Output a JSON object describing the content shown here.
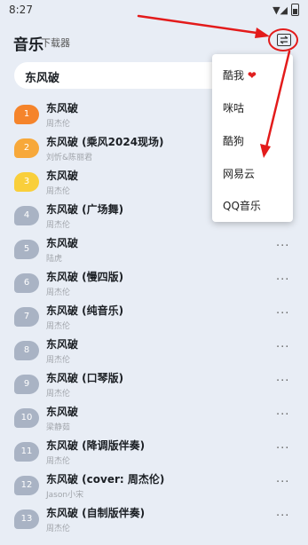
{
  "status_bar": {
    "time": "8:27",
    "signal": "▼◢"
  },
  "header": {
    "title": "音乐",
    "subtitle": "下载器"
  },
  "search": {
    "query": "东风破"
  },
  "results": [
    {
      "rank": "1",
      "title": "东风破",
      "artist": "周杰伦",
      "badge_color": "#f5842b",
      "show_more": false
    },
    {
      "rank": "2",
      "title": "东风破 (乘风2024现场)",
      "artist": "刘忻&陈丽君",
      "badge_color": "#f7a83a",
      "show_more": false
    },
    {
      "rank": "3",
      "title": "东风破",
      "artist": "周杰伦",
      "badge_color": "#f9cf3b",
      "show_more": false
    },
    {
      "rank": "4",
      "title": "东风破 (广场舞)",
      "artist": "周杰伦",
      "badge_color": "#a9b3c4",
      "show_more": false
    },
    {
      "rank": "5",
      "title": "东风破",
      "artist": "陆虎",
      "badge_color": "#a9b3c4",
      "show_more": true
    },
    {
      "rank": "6",
      "title": "东风破 (慢四版)",
      "artist": "周杰伦",
      "badge_color": "#a9b3c4",
      "show_more": true
    },
    {
      "rank": "7",
      "title": "东风破 (纯音乐)",
      "artist": "周杰伦",
      "badge_color": "#a9b3c4",
      "show_more": true
    },
    {
      "rank": "8",
      "title": "东风破",
      "artist": "周杰伦",
      "badge_color": "#a9b3c4",
      "show_more": true
    },
    {
      "rank": "9",
      "title": "东风破 (口琴版)",
      "artist": "周杰伦",
      "badge_color": "#a9b3c4",
      "show_more": true
    },
    {
      "rank": "10",
      "title": "东风破",
      "artist": "梁静茹",
      "badge_color": "#a9b3c4",
      "show_more": true
    },
    {
      "rank": "11",
      "title": "东风破 (降调版伴奏)",
      "artist": "周杰伦",
      "badge_color": "#a9b3c4",
      "show_more": true
    },
    {
      "rank": "12",
      "title": "东风破 (cover: 周杰伦)",
      "artist": "Jason小宋",
      "badge_color": "#a9b3c4",
      "show_more": true
    },
    {
      "rank": "13",
      "title": "东风破 (自制版伴奏)",
      "artist": "周杰伦",
      "badge_color": "#a9b3c4",
      "show_more": true
    }
  ],
  "more_glyph": "···",
  "source_menu": {
    "items": [
      {
        "label": "酷我",
        "heart": "❤"
      },
      {
        "label": "咪咕"
      },
      {
        "label": "酷狗"
      },
      {
        "label": "网易云"
      },
      {
        "label": "QQ音乐"
      }
    ]
  },
  "annotation_color": "#e31b1b"
}
